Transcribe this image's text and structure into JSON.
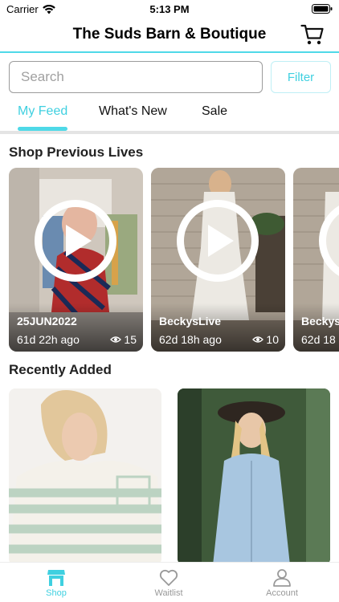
{
  "status_bar": {
    "carrier": "Carrier",
    "time": "5:13 PM"
  },
  "header": {
    "title": "The Suds Barn & Boutique"
  },
  "search": {
    "placeholder": "Search",
    "filter_label": "Filter"
  },
  "tabs": [
    {
      "label": "My Feed",
      "active": true
    },
    {
      "label": "What's New",
      "active": false
    },
    {
      "label": "Sale",
      "active": false
    }
  ],
  "sections": {
    "previous_lives": "Shop Previous Lives",
    "recently_added": "Recently Added"
  },
  "lives": [
    {
      "name": "25JUN2022",
      "age": "61d 22h ago",
      "views": "15"
    },
    {
      "name": "BeckysLive",
      "age": "62d 18h ago",
      "views": "10"
    },
    {
      "name": "BeckysLi",
      "age": "62d 18",
      "views": ""
    }
  ],
  "bottom_nav": [
    {
      "label": "Shop",
      "icon": "shop-icon",
      "active": true
    },
    {
      "label": "Waitlist",
      "icon": "heart-icon",
      "active": false
    },
    {
      "label": "Account",
      "icon": "person-icon",
      "active": false
    }
  ],
  "colors": {
    "accent": "#3fd0e0",
    "header_border": "#4fd9e8"
  }
}
